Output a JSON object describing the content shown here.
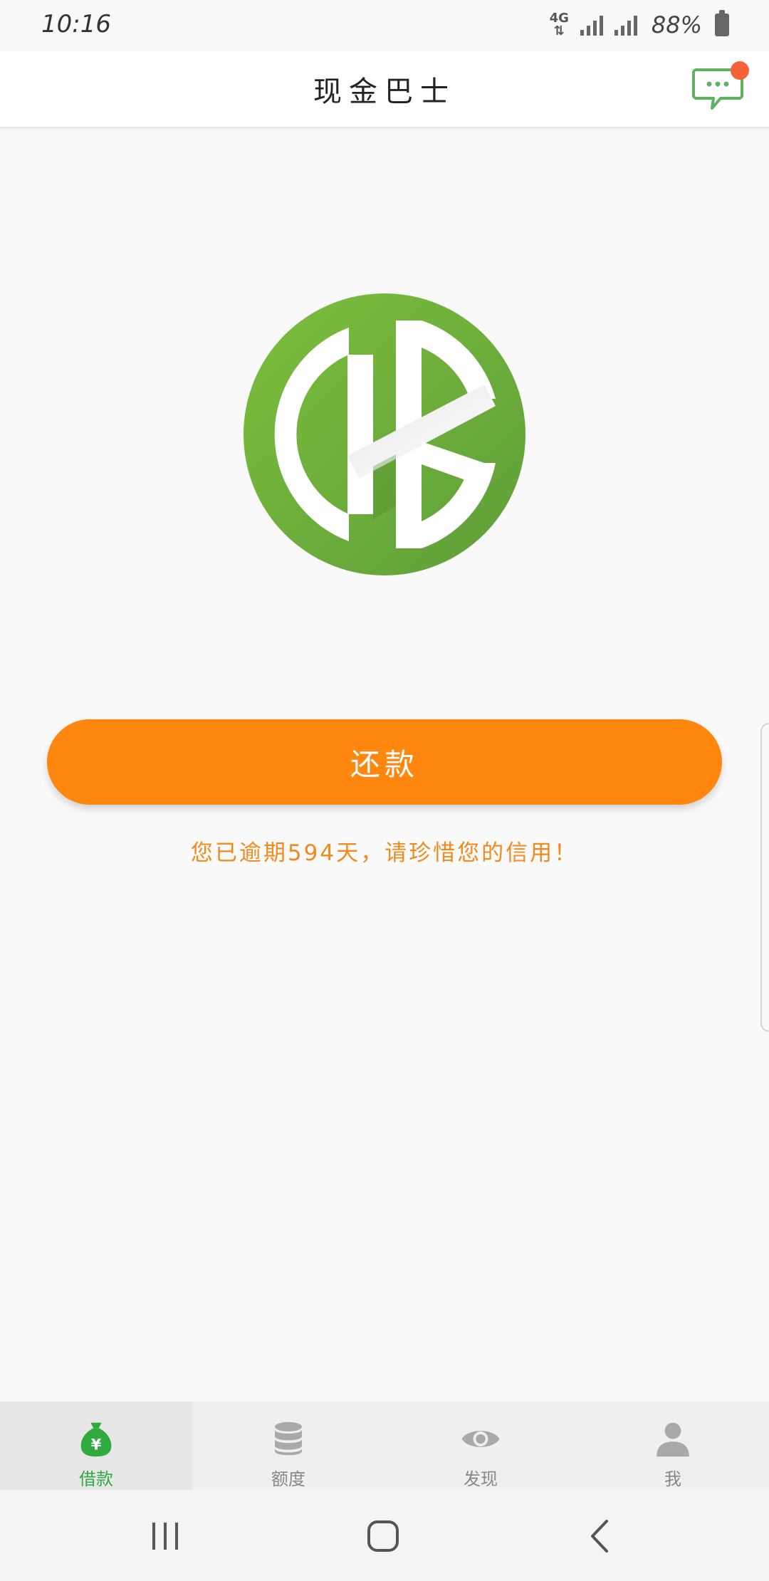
{
  "status_bar": {
    "time": "10:16",
    "network": "4G",
    "battery": "88%"
  },
  "header": {
    "title": "现金巴士"
  },
  "main": {
    "repay_button_label": "还款",
    "overdue_notice": "您已逾期594天，请珍惜您的信用！"
  },
  "tabs": [
    {
      "label": "借款",
      "icon": "money-bag-icon",
      "active": true
    },
    {
      "label": "额度",
      "icon": "database-icon",
      "active": false
    },
    {
      "label": "发现",
      "icon": "eye-icon",
      "active": false
    },
    {
      "label": "我",
      "icon": "person-icon",
      "active": false
    }
  ],
  "colors": {
    "brand_green": "#6db33f",
    "accent_orange": "#ff870f",
    "notice_orange": "#f08a1c",
    "badge_red": "#f4623a",
    "tab_active_green": "#2eaa3f"
  }
}
